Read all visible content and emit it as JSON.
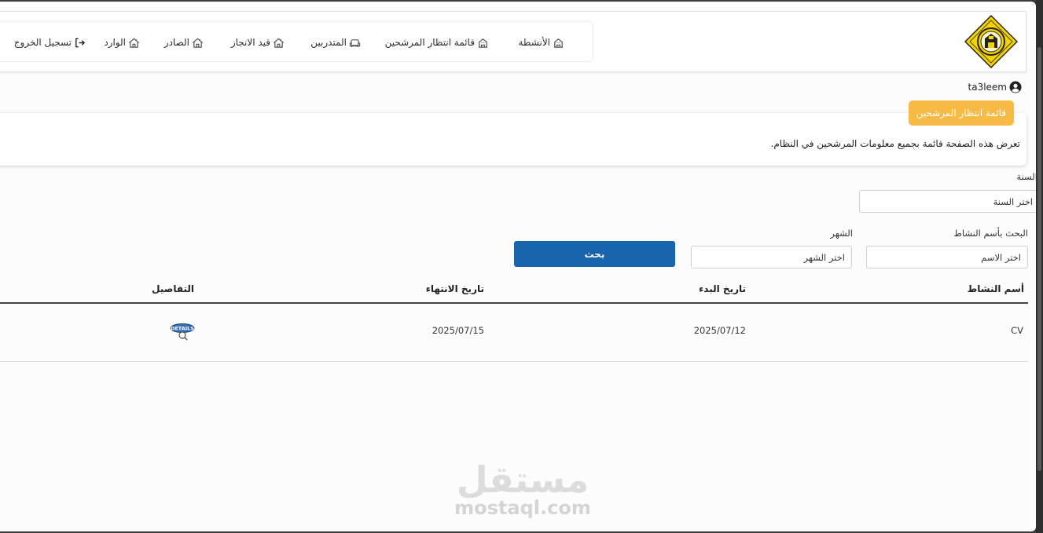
{
  "nav": {
    "items": [
      {
        "label": "الأنشطة",
        "icon": "building-icon"
      },
      {
        "label": "قائمة انتظار المرشحين",
        "icon": "building-icon"
      },
      {
        "label": "المتدربين",
        "icon": "sofa-icon"
      },
      {
        "label": "قيد الانجاز",
        "icon": "house-icon"
      },
      {
        "label": "الصادر",
        "icon": "house-icon"
      },
      {
        "label": "الوارد",
        "icon": "house-icon"
      }
    ],
    "logout_label": "تسجيل الخروج"
  },
  "user": {
    "name": "ta3leem"
  },
  "page": {
    "badge": "قائمة انتظار المرشحين",
    "description": "تعرض هذه الصفحة قائمة بجميع معلومات المرشحين في النظام."
  },
  "filters": {
    "year_label": "السنة",
    "year_value": "اختر السنة",
    "name_label": "البحث بأسم النشاط",
    "name_value": "اختر الاسم",
    "month_label": "الشهر",
    "month_value": "اختر الشهر",
    "search_button": "بحث"
  },
  "table": {
    "headers": {
      "activity": "أسم النشاط",
      "start": "تاريخ البدء",
      "end": "تاريخ الانتهاء",
      "details": "التفاصيل"
    },
    "rows": [
      {
        "activity": "CV",
        "start": "2025/07/12",
        "end": "2025/07/15",
        "details_icon": "details-icon",
        "details_text": "DETAILS"
      }
    ]
  },
  "watermark": {
    "arabic": "مستقل",
    "latin": "mostaql.com"
  },
  "colors": {
    "accent": "#1a63ad",
    "badge": "#f7bb45",
    "logo": "#f5d300"
  }
}
